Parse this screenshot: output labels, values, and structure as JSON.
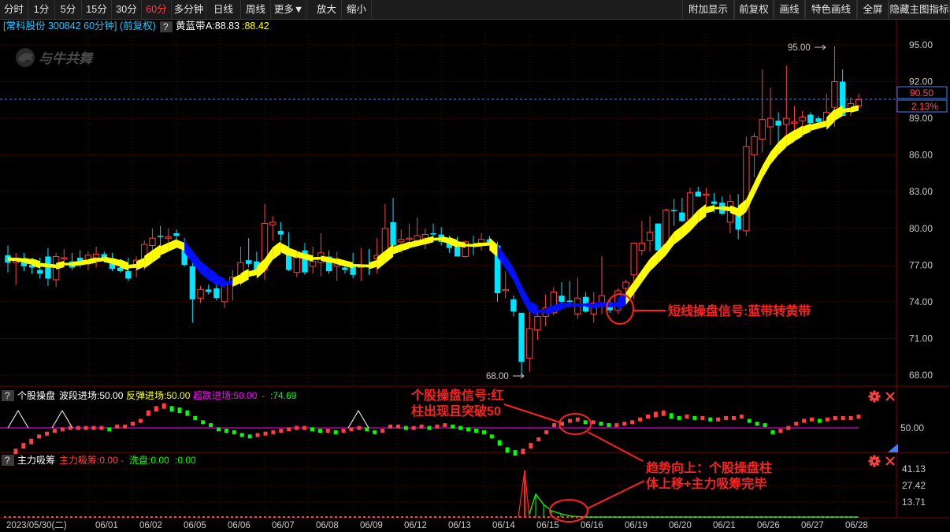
{
  "toolbar": {
    "left": [
      "分时",
      "1分",
      "5分",
      "15分",
      "30分",
      "60分",
      "多分钟",
      "日线",
      "周线",
      "更多▼",
      "放大",
      "缩小"
    ],
    "active": "60分",
    "right": [
      "附加显示",
      "前复权",
      "画线",
      "特色画线",
      "全屏",
      "隐藏主图指标"
    ]
  },
  "main": {
    "stock": "[常科股份 300842 60分钟] (前复权)",
    "help": "?",
    "indicator_name": "黄蓝带",
    "indicator_a": "A:88.83",
    "indicator_b": ":88.42",
    "watermark": "与牛共舞",
    "y_ticks": [
      "95.00",
      "92.00",
      "89.00",
      "86.00",
      "83.00",
      "80.00",
      "77.00",
      "74.00",
      "71.00",
      "68.00"
    ],
    "current_price": "90.50",
    "current_pct": "2.13%",
    "high_label": "95.00",
    "low_label": "68.00",
    "annotation": "短线操盘信号:蓝带转黄带"
  },
  "sub1": {
    "help": "?",
    "title": "个股操盘",
    "p1": "波段进场:50.00",
    "p2": "反弹进场:50.00",
    "p3": "超跌进场:50.00",
    "p4": "-",
    "p5": ":74.69",
    "y_tick": "50.00",
    "annotation1": "个股操盘信号:红",
    "annotation2": "柱出现且突破50"
  },
  "sub2": {
    "help": "?",
    "title": "主力吸筹",
    "p1": "主力吸筹:0.00",
    "p2": "-",
    "p3": "洗盘:0.00",
    "p4": ":0.00",
    "y_ticks": [
      "41.13",
      "27.42",
      "13.71"
    ],
    "annotation1": "趋势向上：个股操盘柱",
    "annotation2": "体上移+主力吸筹完毕"
  },
  "x_axis": [
    "2023/05/30(二)",
    "06/01",
    "06/02",
    "06/05",
    "06/06",
    "06/07",
    "06/08",
    "06/09",
    "06/12",
    "06/13",
    "06/14",
    "06/15",
    "06/16",
    "06/19",
    "06/20",
    "06/21",
    "06/26",
    "06/27",
    "06/28"
  ],
  "colors": {
    "up": "#ff4040",
    "down": "#00e5ff",
    "yellow": "#ffff00",
    "blue": "#0010ff",
    "green": "#00ff00",
    "magenta": "#ff00ff",
    "grid": "#7a0000"
  },
  "icons": [
    "gear-icon",
    "close-icon"
  ]
}
